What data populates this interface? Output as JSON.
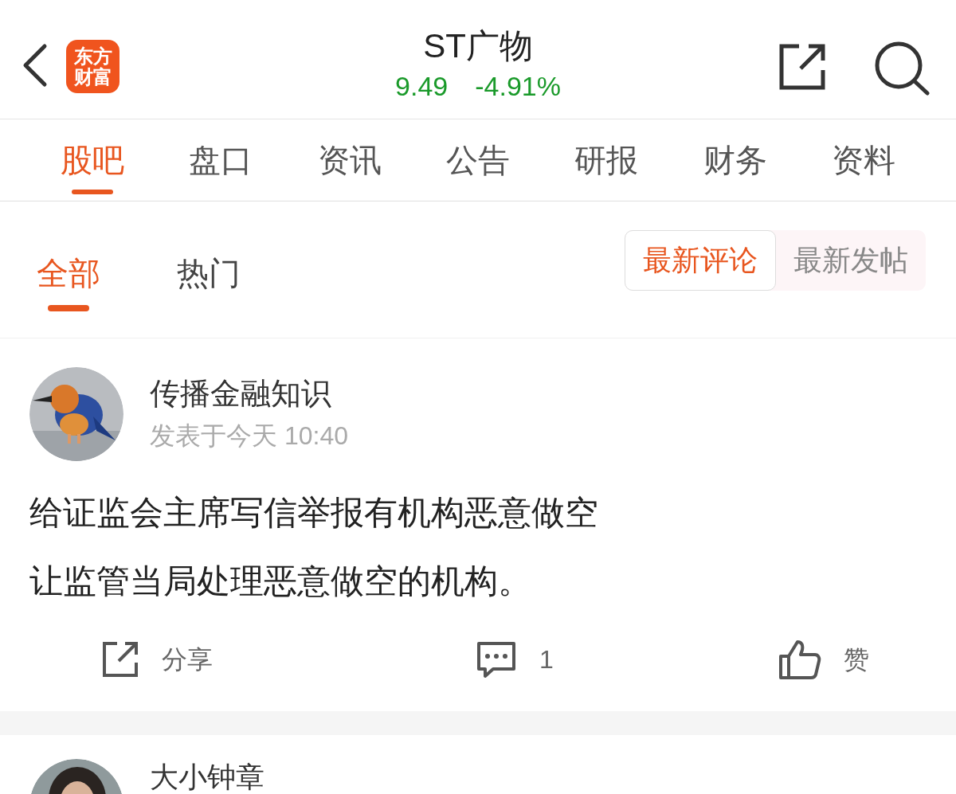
{
  "header": {
    "logo": [
      "东方",
      "财富"
    ],
    "title": "ST广物",
    "price": "9.49",
    "change": "-4.91%"
  },
  "tabs": [
    {
      "label": "股吧",
      "selected": true
    },
    {
      "label": "盘口",
      "selected": false
    },
    {
      "label": "资讯",
      "selected": false
    },
    {
      "label": "公告",
      "selected": false
    },
    {
      "label": "研报",
      "selected": false
    },
    {
      "label": "财务",
      "selected": false
    },
    {
      "label": "资料",
      "selected": false
    }
  ],
  "filter_tabs": [
    {
      "label": "全部",
      "selected": true
    },
    {
      "label": "热门",
      "selected": false
    }
  ],
  "sort_options": [
    {
      "label": "最新评论",
      "selected": true
    },
    {
      "label": "最新发帖",
      "selected": false
    }
  ],
  "posts": [
    {
      "author": "传播金融知识",
      "time": "发表于今天 10:40",
      "content": [
        "给证监会主席写信举报有机构恶意做空",
        "让监管当局处理恶意做空的机构。"
      ],
      "actions": [
        {
          "kind": "share",
          "label": "分享"
        },
        {
          "kind": "comment",
          "label": "1"
        },
        {
          "kind": "like",
          "label": "赞"
        }
      ]
    },
    {
      "author": "大小钟章"
    }
  ]
}
